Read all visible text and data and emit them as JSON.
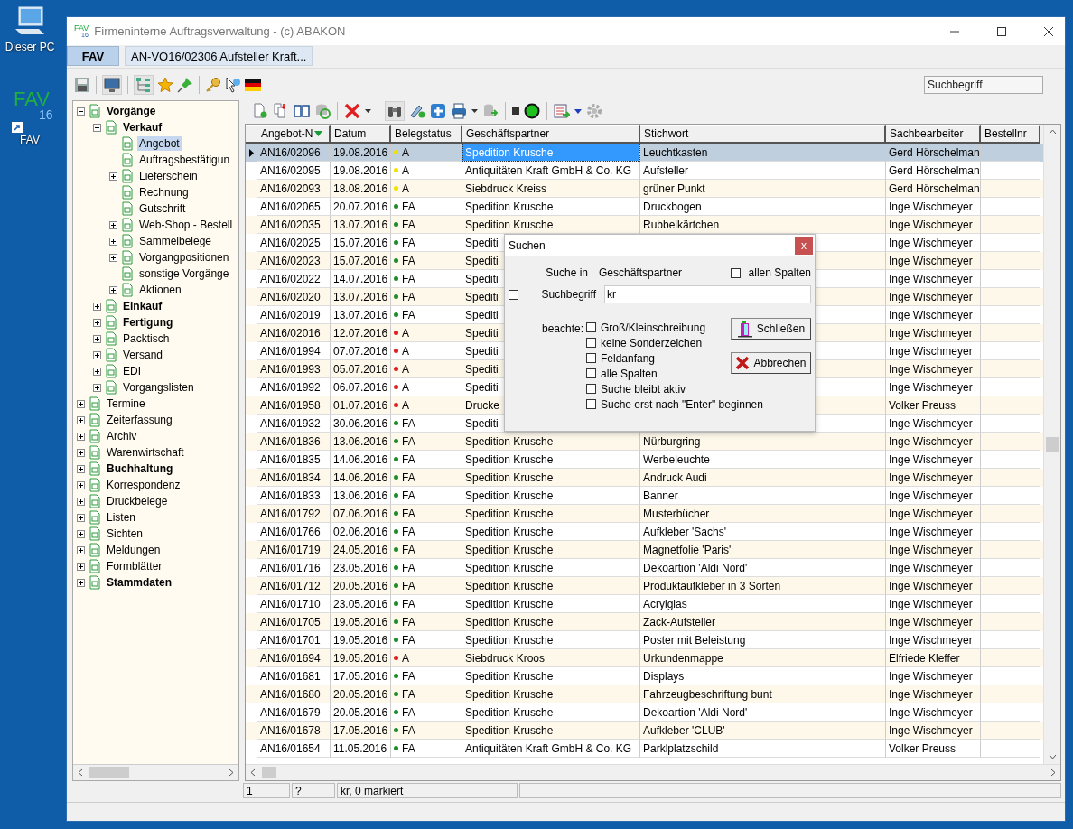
{
  "desktop": {
    "icons": [
      {
        "label": "Dieser PC",
        "kind": "computer"
      },
      {
        "label": "FAV",
        "kind": "logo",
        "logo_text": "FAV",
        "logo_sub": "16"
      }
    ]
  },
  "window": {
    "title": "Firmeninterne Auftragsverwaltung - (c) ABAKON",
    "logo_text": "FAV",
    "logo_sub": "16"
  },
  "tabs": [
    {
      "label": "FAV",
      "selected": true
    },
    {
      "label": "AN-VO16/02306 Aufsteller Kraft...",
      "selected": false
    }
  ],
  "search": {
    "placeholder": "Suchbegriff"
  },
  "tree": [
    {
      "label": "Vorgänge",
      "bold": true,
      "expanded": true,
      "selected": false,
      "children": [
        {
          "label": "Verkauf",
          "bold": true,
          "expanded": true,
          "selected": false,
          "children": [
            {
              "label": "Angebot",
              "bold": false,
              "selected": true
            },
            {
              "label": "Auftragsbestätigun",
              "bold": false,
              "selected": false
            },
            {
              "label": "Lieferschein",
              "bold": false,
              "expanded": false,
              "selected": false
            },
            {
              "label": "Rechnung",
              "bold": false,
              "selected": false
            },
            {
              "label": "Gutschrift",
              "bold": false,
              "selected": false
            },
            {
              "label": "Web-Shop - Bestell",
              "bold": false,
              "expanded": false,
              "selected": false
            },
            {
              "label": "Sammelbelege",
              "bold": false,
              "expanded": false,
              "selected": false
            },
            {
              "label": "Vorgangpositionen",
              "bold": false,
              "expanded": false,
              "selected": false
            },
            {
              "label": "sonstige Vorgänge",
              "bold": false,
              "selected": false
            },
            {
              "label": "Aktionen",
              "bold": false,
              "expanded": false,
              "selected": false
            }
          ]
        },
        {
          "label": "Einkauf",
          "bold": true,
          "expanded": false,
          "selected": false
        },
        {
          "label": "Fertigung",
          "bold": true,
          "expanded": false,
          "selected": false
        },
        {
          "label": "Packtisch",
          "bold": false,
          "expanded": false,
          "selected": false
        },
        {
          "label": "Versand",
          "bold": false,
          "expanded": false,
          "selected": false
        },
        {
          "label": "EDI",
          "bold": false,
          "expanded": false,
          "selected": false
        },
        {
          "label": "Vorgangslisten",
          "bold": false,
          "expanded": false,
          "selected": false
        }
      ]
    },
    {
      "label": "Termine",
      "bold": false,
      "expanded": false,
      "selected": false
    },
    {
      "label": "Zeiterfassung",
      "bold": false,
      "expanded": false,
      "selected": false
    },
    {
      "label": "Archiv",
      "bold": false,
      "expanded": false,
      "selected": false
    },
    {
      "label": "Warenwirtschaft",
      "bold": false,
      "expanded": false,
      "selected": false
    },
    {
      "label": "Buchhaltung",
      "bold": true,
      "expanded": false,
      "selected": false
    },
    {
      "label": "Korrespondenz",
      "bold": false,
      "expanded": false,
      "selected": false
    },
    {
      "label": "Druckbelege",
      "bold": false,
      "expanded": false,
      "selected": false
    },
    {
      "label": "Listen",
      "bold": false,
      "expanded": false,
      "selected": false
    },
    {
      "label": "Sichten",
      "bold": false,
      "expanded": false,
      "selected": false
    },
    {
      "label": "Meldungen",
      "bold": false,
      "expanded": false,
      "selected": false
    },
    {
      "label": "Formblätter",
      "bold": false,
      "expanded": false,
      "selected": false
    },
    {
      "label": "Stammdaten",
      "bold": true,
      "expanded": false,
      "selected": false
    }
  ],
  "table": {
    "columns": [
      {
        "label": "Angebot-N",
        "sorted": true
      },
      {
        "label": "Datum",
        "sorted": false
      },
      {
        "label": "Belegstatus",
        "sorted": false
      },
      {
        "label": "Geschäftspartner",
        "sorted": false
      },
      {
        "label": "Stichwort",
        "sorted": false
      },
      {
        "label": "Sachbearbeiter",
        "sorted": false
      },
      {
        "label": "Bestellnr",
        "sorted": false
      }
    ],
    "rows": [
      {
        "nr": "AN16/02096",
        "datum": "19.08.2016",
        "status": "A",
        "color": "#f2e200",
        "partner": "Spedition Krusche",
        "stichwort": "Leuchtkasten",
        "bearbeiter": "Gerd Hörschelman",
        "selected": true
      },
      {
        "nr": "AN16/02095",
        "datum": "19.08.2016",
        "status": "A",
        "color": "#f2e200",
        "partner": "Antiquitäten Kraft GmbH & Co. KG",
        "stichwort": "Aufsteller",
        "bearbeiter": "Gerd Hörschelman",
        "selected": false
      },
      {
        "nr": "AN16/02093",
        "datum": "18.08.2016",
        "status": "A",
        "color": "#f2e200",
        "partner": "Siebdruck Kreiss",
        "stichwort": "grüner Punkt",
        "bearbeiter": "Gerd Hörschelman",
        "selected": false
      },
      {
        "nr": "AN16/02065",
        "datum": "20.07.2016",
        "status": "FA",
        "color": "#1e8c2a",
        "partner": "Spedition Krusche",
        "stichwort": "Druckbogen",
        "bearbeiter": "Inge Wischmeyer",
        "selected": false
      },
      {
        "nr": "AN16/02035",
        "datum": "13.07.2016",
        "status": "FA",
        "color": "#1e8c2a",
        "partner": "Spedition Krusche",
        "stichwort": "Rubbelkärtchen",
        "bearbeiter": "Inge Wischmeyer",
        "selected": false
      },
      {
        "nr": "AN16/02025",
        "datum": "15.07.2016",
        "status": "FA",
        "color": "#1e8c2a",
        "partner": "Spediti",
        "bearbeiter": "Inge Wischmeyer",
        "selected": false
      },
      {
        "nr": "AN16/02023",
        "datum": "15.07.2016",
        "status": "FA",
        "color": "#1e8c2a",
        "partner": "Spediti",
        "bearbeiter": "Inge Wischmeyer",
        "selected": false
      },
      {
        "nr": "AN16/02022",
        "datum": "14.07.2016",
        "status": "FA",
        "color": "#1e8c2a",
        "partner": "Spediti",
        "bearbeiter": "Inge Wischmeyer",
        "selected": false
      },
      {
        "nr": "AN16/02020",
        "datum": "13.07.2016",
        "status": "FA",
        "color": "#1e8c2a",
        "partner": "Spediti",
        "bearbeiter": "Inge Wischmeyer",
        "selected": false
      },
      {
        "nr": "AN16/02019",
        "datum": "13.07.2016",
        "status": "FA",
        "color": "#1e8c2a",
        "partner": "Spediti",
        "bearbeiter": "Inge Wischmeyer",
        "selected": false
      },
      {
        "nr": "AN16/02016",
        "datum": "12.07.2016",
        "status": "A",
        "color": "#e02020",
        "partner": "Spediti",
        "bearbeiter": "Inge Wischmeyer",
        "selected": false
      },
      {
        "nr": "AN16/01994",
        "datum": "07.07.2016",
        "status": "A",
        "color": "#e02020",
        "partner": "Spediti",
        "bearbeiter": "Inge Wischmeyer",
        "selected": false
      },
      {
        "nr": "AN16/01993",
        "datum": "05.07.2016",
        "status": "A",
        "color": "#e02020",
        "partner": "Spediti",
        "bearbeiter": "Inge Wischmeyer",
        "selected": false
      },
      {
        "nr": "AN16/01992",
        "datum": "06.07.2016",
        "status": "A",
        "color": "#e02020",
        "partner": "Spediti",
        "bearbeiter": "Inge Wischmeyer",
        "selected": false
      },
      {
        "nr": "AN16/01958",
        "datum": "01.07.2016",
        "status": "A",
        "color": "#e02020",
        "partner": "Drucke",
        "bearbeiter": "Volker Preuss",
        "selected": false
      },
      {
        "nr": "AN16/01932",
        "datum": "30.06.2016",
        "status": "FA",
        "color": "#1e8c2a",
        "partner": "Spediti",
        "bearbeiter": "Inge Wischmeyer",
        "selected": false
      },
      {
        "nr": "AN16/01836",
        "datum": "13.06.2016",
        "status": "FA",
        "color": "#1e8c2a",
        "partner": "Spedition Krusche",
        "stichwort": "Nürburgring",
        "bearbeiter": "Inge Wischmeyer",
        "selected": false
      },
      {
        "nr": "AN16/01835",
        "datum": "14.06.2016",
        "status": "FA",
        "color": "#1e8c2a",
        "partner": "Spedition Krusche",
        "stichwort": "Werbeleuchte",
        "bearbeiter": "Inge Wischmeyer",
        "selected": false
      },
      {
        "nr": "AN16/01834",
        "datum": "14.06.2016",
        "status": "FA",
        "color": "#1e8c2a",
        "partner": "Spedition Krusche",
        "stichwort": "Andruck Audi",
        "bearbeiter": "Inge Wischmeyer",
        "selected": false
      },
      {
        "nr": "AN16/01833",
        "datum": "13.06.2016",
        "status": "FA",
        "color": "#1e8c2a",
        "partner": "Spedition Krusche",
        "stichwort": "Banner",
        "bearbeiter": "Inge Wischmeyer",
        "selected": false
      },
      {
        "nr": "AN16/01792",
        "datum": "07.06.2016",
        "status": "FA",
        "color": "#1e8c2a",
        "partner": "Spedition Krusche",
        "stichwort": "Musterbücher",
        "bearbeiter": "Inge Wischmeyer",
        "selected": false
      },
      {
        "nr": "AN16/01766",
        "datum": "02.06.2016",
        "status": "FA",
        "color": "#1e8c2a",
        "partner": "Spedition Krusche",
        "stichwort": "Aufkleber 'Sachs'",
        "bearbeiter": "Inge Wischmeyer",
        "selected": false
      },
      {
        "nr": "AN16/01719",
        "datum": "24.05.2016",
        "status": "FA",
        "color": "#1e8c2a",
        "partner": "Spedition Krusche",
        "stichwort": "Magnetfolie 'Paris'",
        "bearbeiter": "Inge Wischmeyer",
        "selected": false
      },
      {
        "nr": "AN16/01716",
        "datum": "23.05.2016",
        "status": "FA",
        "color": "#1e8c2a",
        "partner": "Spedition Krusche",
        "stichwort": "Dekoartion 'Aldi Nord'",
        "bearbeiter": "Inge Wischmeyer",
        "selected": false
      },
      {
        "nr": "AN16/01712",
        "datum": "20.05.2016",
        "status": "FA",
        "color": "#1e8c2a",
        "partner": "Spedition Krusche",
        "stichwort": "Produktaufkleber in 3 Sorten",
        "bearbeiter": "Inge Wischmeyer",
        "selected": false
      },
      {
        "nr": "AN16/01710",
        "datum": "23.05.2016",
        "status": "FA",
        "color": "#1e8c2a",
        "partner": "Spedition Krusche",
        "stichwort": "Acrylglas",
        "bearbeiter": "Inge Wischmeyer",
        "selected": false
      },
      {
        "nr": "AN16/01705",
        "datum": "19.05.2016",
        "status": "FA",
        "color": "#1e8c2a",
        "partner": "Spedition Krusche",
        "stichwort": "Zack-Aufsteller",
        "bearbeiter": "Inge Wischmeyer",
        "selected": false
      },
      {
        "nr": "AN16/01701",
        "datum": "19.05.2016",
        "status": "FA",
        "color": "#1e8c2a",
        "partner": "Spedition Krusche",
        "stichwort": "Poster mit Beleistung",
        "bearbeiter": "Inge Wischmeyer",
        "selected": false
      },
      {
        "nr": "AN16/01694",
        "datum": "19.05.2016",
        "status": "A",
        "color": "#e02020",
        "partner": "Siebdruck Kroos",
        "stichwort": "Urkundenmappe",
        "bearbeiter": "Elfriede Kleffer",
        "selected": false
      },
      {
        "nr": "AN16/01681",
        "datum": "17.05.2016",
        "status": "FA",
        "color": "#1e8c2a",
        "partner": "Spedition Krusche",
        "stichwort": "Displays",
        "bearbeiter": "Inge Wischmeyer",
        "selected": false
      },
      {
        "nr": "AN16/01680",
        "datum": "20.05.2016",
        "status": "FA",
        "color": "#1e8c2a",
        "partner": "Spedition Krusche",
        "stichwort": "Fahrzeugbeschriftung bunt",
        "bearbeiter": "Inge Wischmeyer",
        "selected": false
      },
      {
        "nr": "AN16/01679",
        "datum": "20.05.2016",
        "status": "FA",
        "color": "#1e8c2a",
        "partner": "Spedition Krusche",
        "stichwort": "Dekoartion 'Aldi Nord'",
        "bearbeiter": "Inge Wischmeyer",
        "selected": false
      },
      {
        "nr": "AN16/01678",
        "datum": "17.05.2016",
        "status": "FA",
        "color": "#1e8c2a",
        "partner": "Spedition Krusche",
        "stichwort": "Aufkleber 'CLUB'",
        "bearbeiter": "Inge Wischmeyer",
        "selected": false
      },
      {
        "nr": "AN16/01654",
        "datum": "11.05.2016",
        "status": "FA",
        "color": "#1e8c2a",
        "partner": "Antiquitäten Kraft GmbH & Co. KG",
        "stichwort": "Parklplatzschild",
        "bearbeiter": "Volker Preuss",
        "selected": false
      }
    ]
  },
  "status_bar": [
    "1",
    "?",
    "kr, 0 markiert"
  ],
  "dialog": {
    "title": "Suchen",
    "close": "x",
    "suche_in_label": "Suche in",
    "suche_in_value": "Geschäftspartner",
    "all_columns": {
      "label": "allen Spalten",
      "checked": false
    },
    "term_checkbox": {
      "checked": false
    },
    "term_label": "Suchbegriff",
    "term_value": "kr",
    "beachte_label": "beachte:",
    "options": [
      {
        "label": "Groß/Kleinschreibung",
        "checked": false
      },
      {
        "label": "keine Sonderzeichen",
        "checked": false
      },
      {
        "label": "Feldanfang",
        "checked": false
      },
      {
        "label": "alle Spalten",
        "checked": false
      },
      {
        "label": "Suche bleibt aktiv",
        "checked": false
      },
      {
        "label": "Suche erst nach \"Enter\" beginnen",
        "checked": false
      }
    ],
    "buttons": [
      "Schließen",
      "Abbrechen"
    ]
  }
}
